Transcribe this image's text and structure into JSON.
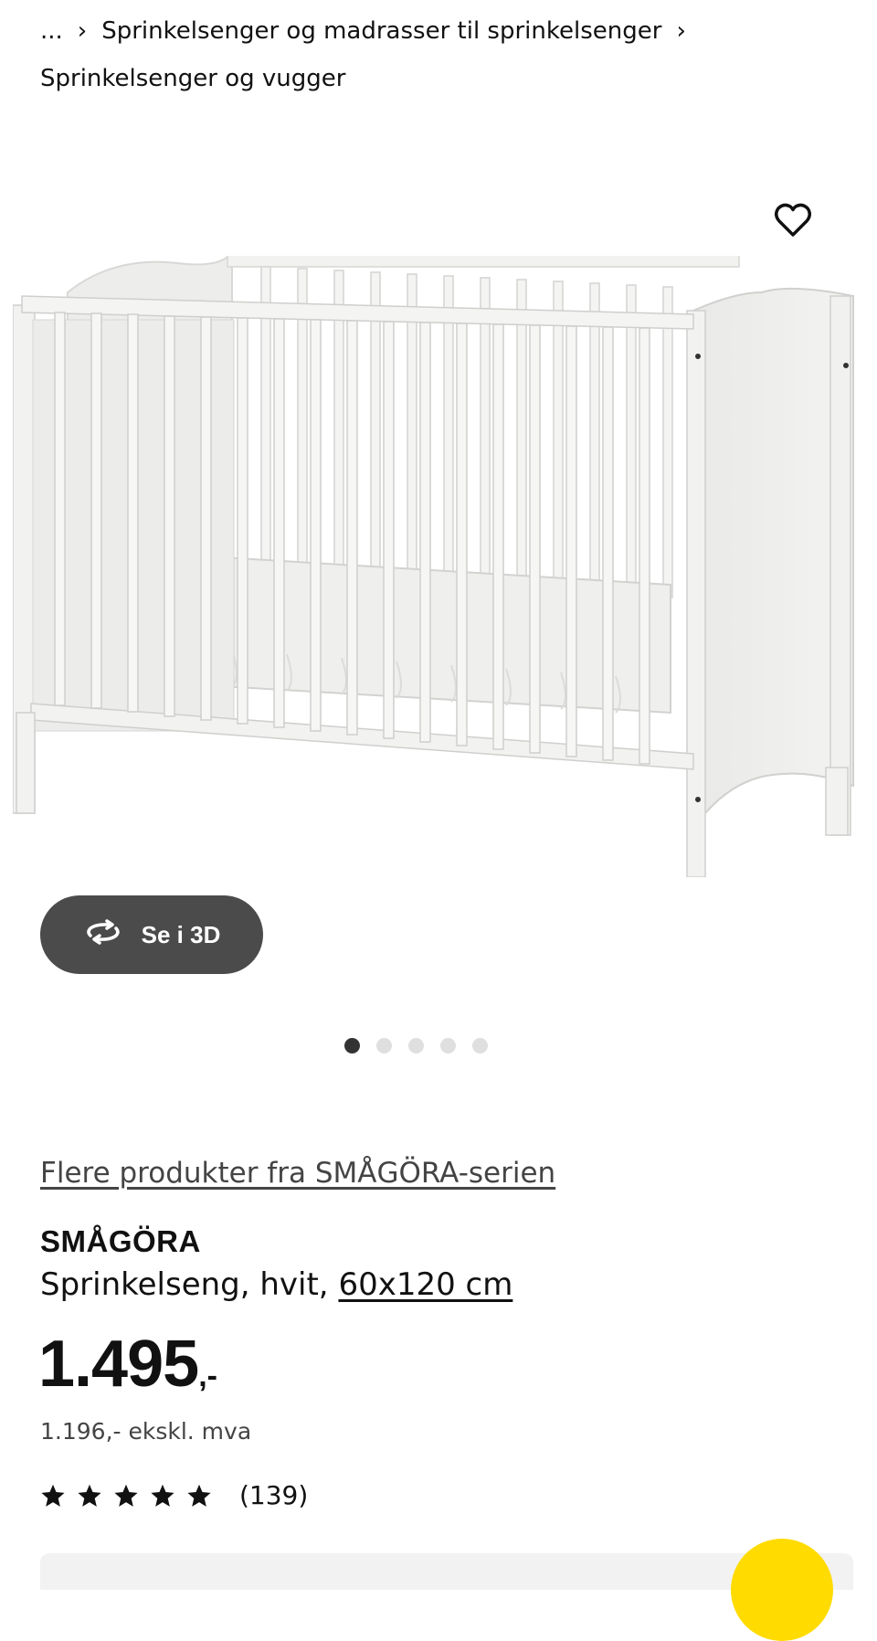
{
  "breadcrumb": {
    "ellipsis": "...",
    "items": [
      "Sprinkelsenger og madrasser til sprinkelsenger",
      "Sprinkelsenger og vugger"
    ],
    "separator": "›"
  },
  "gallery": {
    "favorite_icon": "heart-outline-icon",
    "view_3d_label": "Se i 3D",
    "view_3d_icon": "rotate-3d-icon",
    "slides_total": 5,
    "active_slide": 1
  },
  "product": {
    "series_link": "Flere produkter fra SMÅGÖRA-serien",
    "name": "SMÅGÖRA",
    "description": "Sprinkelseng, hvit,",
    "size": "60x120 cm",
    "price_main": "1.495",
    "price_suffix": ",-",
    "price_excl_vat": "1.196,- ekskl. mva",
    "rating": {
      "stars": 5,
      "count": "(139)"
    }
  },
  "colors": {
    "accent_yellow": "#ffdb00",
    "button_dark": "#4b4b4b",
    "text": "#111111"
  }
}
